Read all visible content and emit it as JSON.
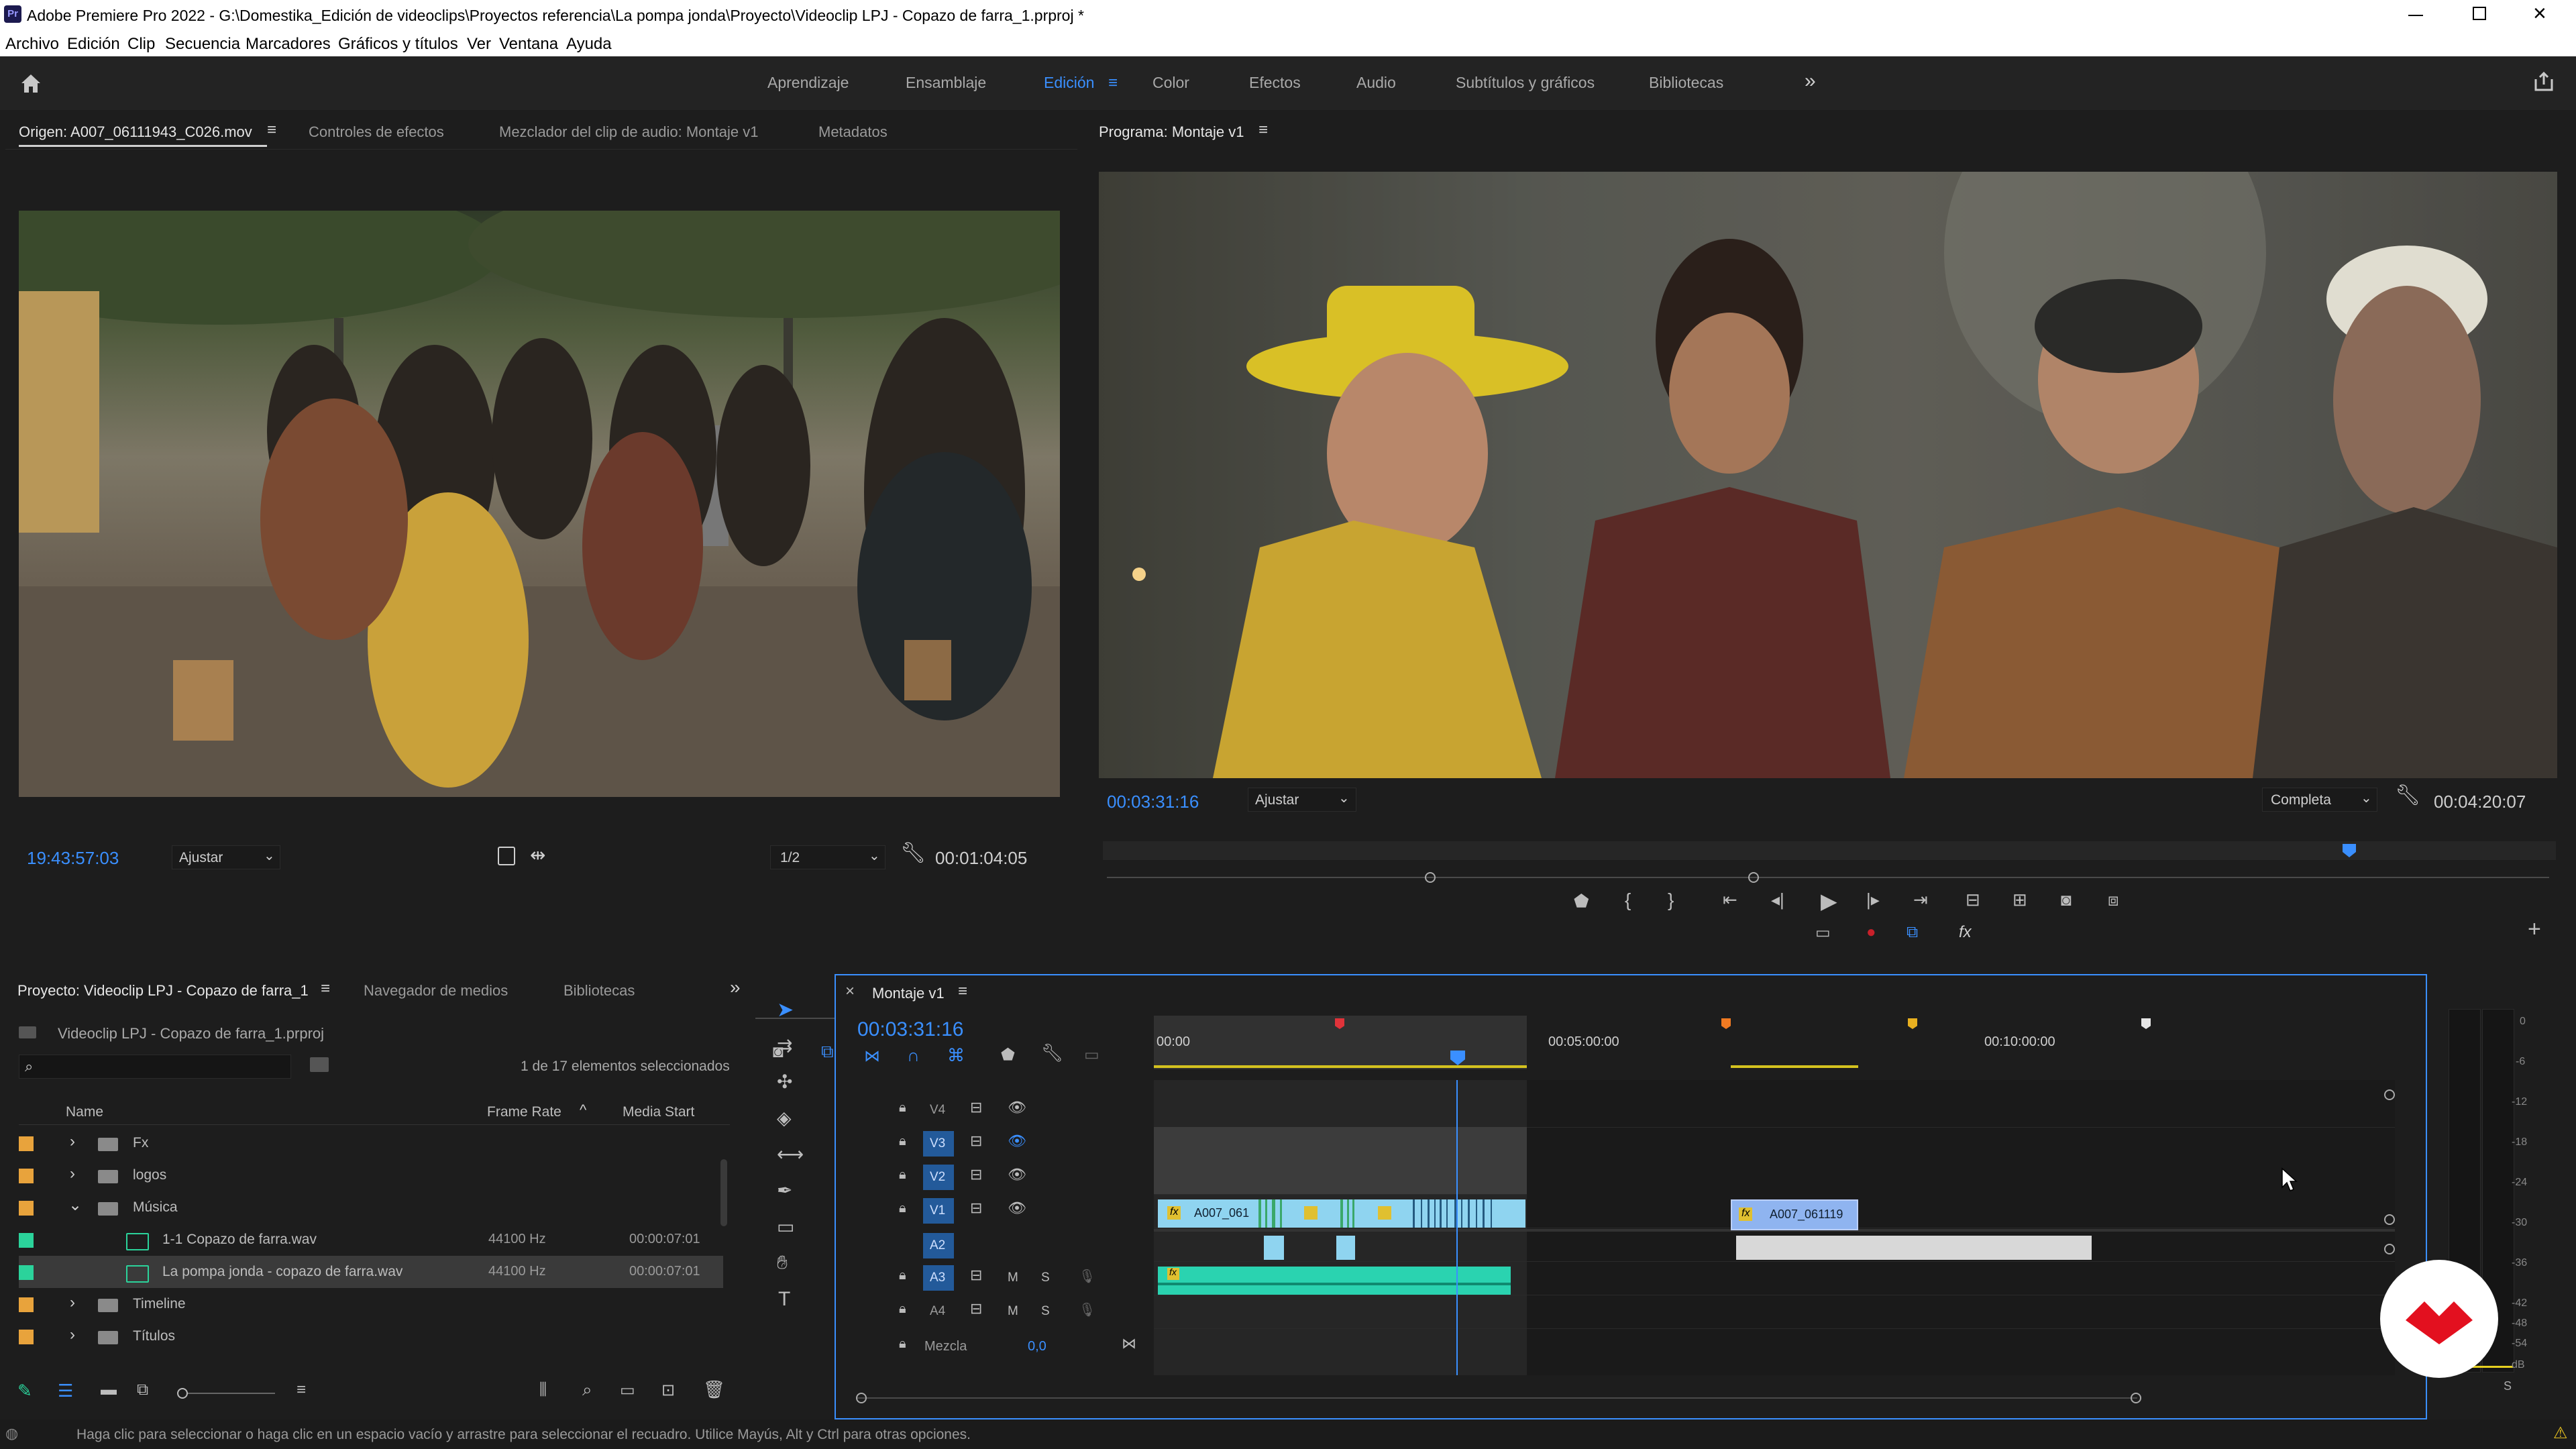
{
  "titlebar": {
    "app_badge": "Pr",
    "title": "Adobe Premiere Pro 2022 - G:\\Domestika_Edición de videoclips\\Proyectos referencia\\La pompa jonda\\Proyecto\\Videoclip LPJ - Copazo de farra_1.prproj *"
  },
  "menu": [
    "Archivo",
    "Edición",
    "Clip",
    "Secuencia",
    "Marcadores",
    "Gráficos y títulos",
    "Ver",
    "Ventana",
    "Ayuda"
  ],
  "workspaces": [
    "Aprendizaje",
    "Ensamblaje",
    "Edición",
    "Color",
    "Efectos",
    "Audio",
    "Subtítulos y gráficos",
    "Bibliotecas"
  ],
  "active_workspace": "Edición",
  "source_panel": {
    "tabs": [
      "Origen: A007_06111943_C026.mov",
      "Controles de efectos",
      "Mezclador del clip de audio: Montaje v1",
      "Metadatos"
    ],
    "timecode": "19:43:57:03",
    "fit": "Ajustar",
    "resolution": "1/2",
    "duration": "00:01:04:05"
  },
  "program_panel": {
    "tab": "Programa: Montaje v1",
    "timecode": "00:03:31:16",
    "fit": "Ajustar",
    "quality": "Completa",
    "duration": "00:04:20:07",
    "fx_label": "fx"
  },
  "project_panel": {
    "tabs": [
      "Proyecto: Videoclip LPJ - Copazo de farra_1",
      "Navegador de medios",
      "Bibliotecas"
    ],
    "project_file": "Videoclip LPJ - Copazo de farra_1.prproj",
    "selection_count": "1 de 17 elementos seleccionados",
    "columns": [
      "Name",
      "Frame Rate",
      "Media Start"
    ],
    "rows": [
      {
        "name": "Fx",
        "type": "folder",
        "color": "#e8a33c",
        "frame_rate": "",
        "media_start": ""
      },
      {
        "name": "logos",
        "type": "folder",
        "color": "#e8a33c",
        "frame_rate": "",
        "media_start": ""
      },
      {
        "name": "Música",
        "type": "folder",
        "color": "#e8a33c",
        "frame_rate": "",
        "media_start": ""
      },
      {
        "name": "1-1 Copazo de farra.wav",
        "type": "audio",
        "color": "#2bd39b",
        "frame_rate": "44100 Hz",
        "media_start": "00:00:07:01"
      },
      {
        "name": "La pompa jonda - copazo de farra.wav",
        "type": "audio",
        "color": "#2bd39b",
        "frame_rate": "44100 Hz",
        "media_start": "00:00:07:01"
      },
      {
        "name": "Timeline",
        "type": "folder",
        "color": "#e8a33c",
        "frame_rate": "",
        "media_start": ""
      },
      {
        "name": "Títulos",
        "type": "folder",
        "color": "#e8a33c",
        "frame_rate": "",
        "media_start": ""
      }
    ]
  },
  "timeline": {
    "tab": "Montaje v1",
    "timecode": "00:03:31:16",
    "ruler": [
      "00:00",
      "00:05:00:00",
      "00:10:00:00"
    ],
    "tracks": [
      "V4",
      "V3",
      "V2",
      "V1",
      "A2",
      "A3",
      "A4"
    ],
    "mute_label": "M",
    "solo_label": "S",
    "mix_label": "Mezcla",
    "mix_value": "0,0",
    "clips": [
      "A007_061",
      "A007_061119"
    ],
    "fx_label": "fx"
  },
  "meter": {
    "scale": [
      "0",
      "-6",
      "-12",
      "-18",
      "-24",
      "-30",
      "-36",
      "-42",
      "-48",
      "-54",
      "dB"
    ],
    "solo": "S"
  },
  "status_bar": "Haga clic para seleccionar o haga clic en un espacio vacío y arrastre para seleccionar el recuadro. Utilice Mayús, Alt y Ctrl para otras opciones."
}
